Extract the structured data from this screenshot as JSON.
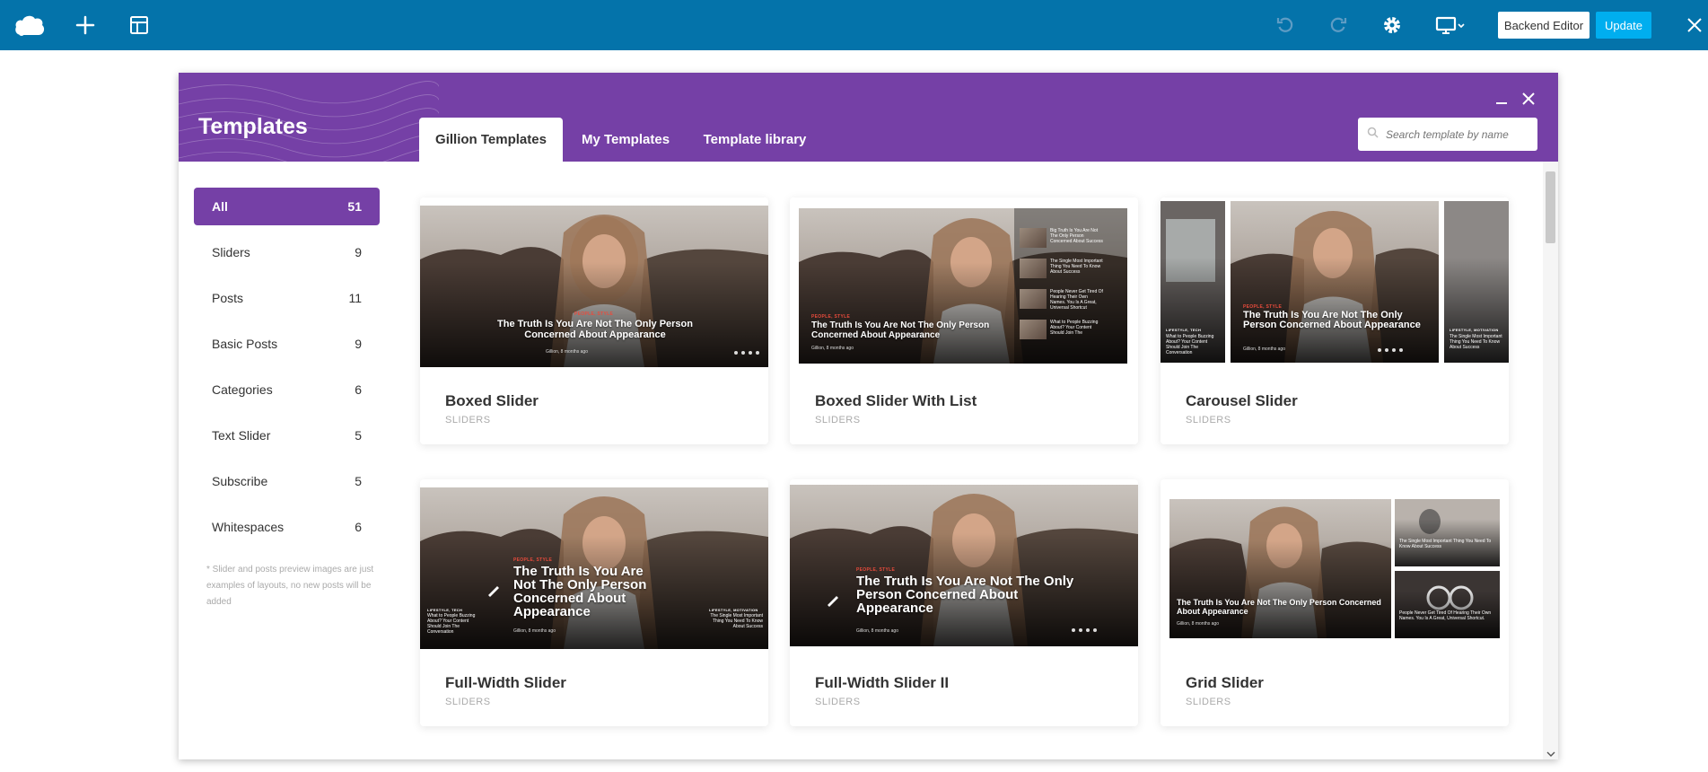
{
  "toolbar": {
    "icons": [
      "cloud-logo-icon",
      "plus-icon",
      "layout-icon",
      "undo-icon",
      "redo-icon",
      "gear-icon",
      "monitor-icon"
    ],
    "backend_label": "Backend Editor",
    "update_label": "Update",
    "colors": {
      "bar": "#0473aa",
      "update": "#00aeef"
    }
  },
  "modal": {
    "title": "Templates",
    "accent": "#7540a6",
    "tabs": [
      {
        "label": "Gillion Templates",
        "active": true
      },
      {
        "label": "My Templates",
        "active": false
      },
      {
        "label": "Template library",
        "active": false
      }
    ],
    "search_placeholder": "Search template by name"
  },
  "categories": [
    {
      "label": "All",
      "count": "51",
      "active": true
    },
    {
      "label": "Sliders",
      "count": "9"
    },
    {
      "label": "Posts",
      "count": "11"
    },
    {
      "label": "Basic Posts",
      "count": "9"
    },
    {
      "label": "Categories",
      "count": "6"
    },
    {
      "label": "Text Slider",
      "count": "5"
    },
    {
      "label": "Subscribe",
      "count": "5"
    },
    {
      "label": "Whitespaces",
      "count": "6"
    }
  ],
  "sidebar_note": "* Slider and posts preview images are just examples of layouts, no new posts will be added",
  "preview": {
    "headline": "The Truth Is You Are Not The Only Person Concerned About Appearance",
    "label": "PEOPLE, STYLE",
    "side_label_left": "LIFESTYLE, TECH",
    "side_label_right": "LIFESTYLE, MOTIVATION",
    "side_text_left": "What to People Buzzing About? Your Content Should Join The Conversation",
    "side_text_right": "The Single Most Important Thing You Need To Know About Success",
    "meta": "Gillion, 8 months ago",
    "list": [
      "Big Truth Is You Are Not The Only Person Concerned About Success",
      "The Single Most Important Thing You Need To Know About Success",
      "People Never Get Tired Of Hearing Their Own Names. You Is A Great, Universal Shortcut",
      "What to People Buzzing About? Your Content Should Join The"
    ],
    "grid_side": [
      "The Single Most Important Thing You Need To Know About Success",
      "People Never Get Tired Of Hearing Their Own Names. You Is A Great, Universal Shortcut."
    ]
  },
  "templates": [
    {
      "name": "Boxed Slider",
      "category": "SLIDERS"
    },
    {
      "name": "Boxed Slider With List",
      "category": "SLIDERS"
    },
    {
      "name": "Carousel Slider",
      "category": "SLIDERS"
    },
    {
      "name": "Full-Width Slider",
      "category": "SLIDERS"
    },
    {
      "name": "Full-Width Slider II",
      "category": "SLIDERS"
    },
    {
      "name": "Grid Slider",
      "category": "SLIDERS"
    }
  ]
}
